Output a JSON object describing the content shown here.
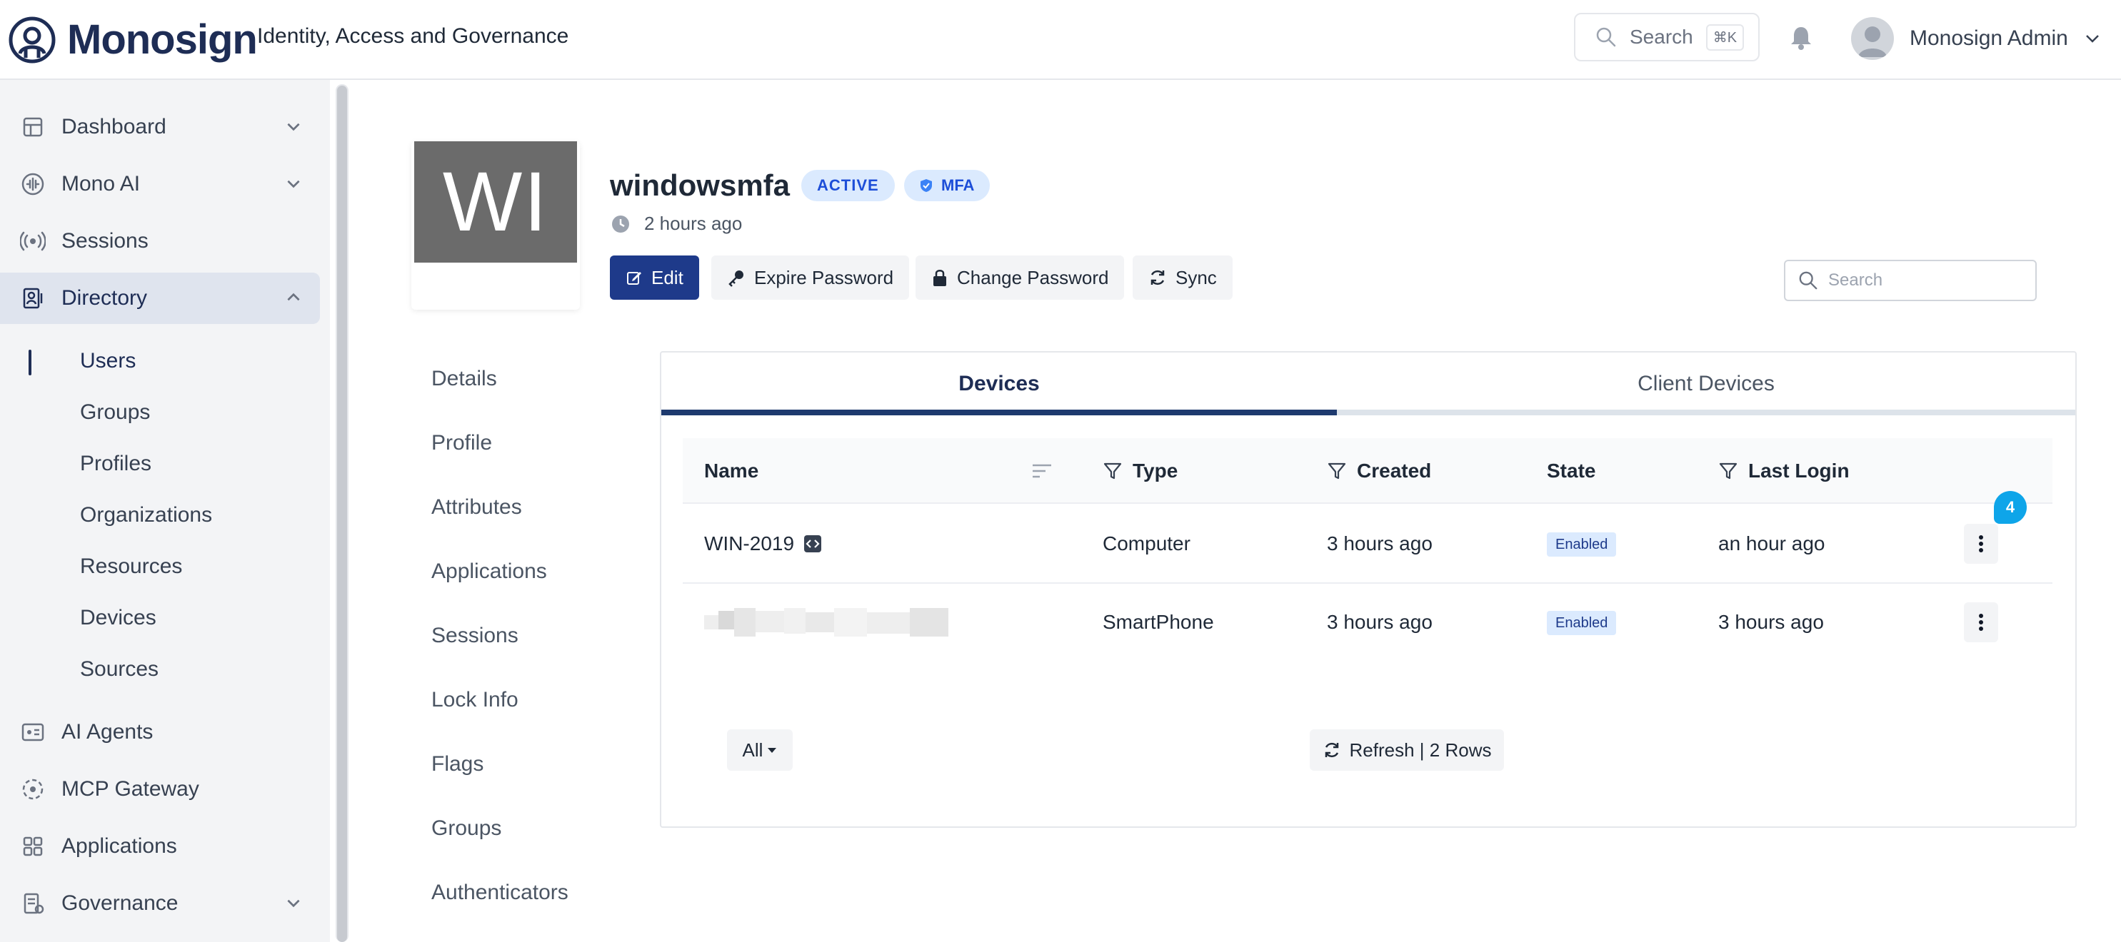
{
  "topbar": {
    "brand": "Monosign",
    "tagline": "Identity, Access and Governance",
    "search_label": "Search",
    "search_shortcut": "⌘K",
    "user_name": "Monosign Admin"
  },
  "sidebar": {
    "items": [
      {
        "label": "Dashboard",
        "icon": "dashboard-icon"
      },
      {
        "label": "Mono AI",
        "icon": "waveform-icon"
      },
      {
        "label": "Sessions",
        "icon": "broadcast-icon"
      },
      {
        "label": "Directory",
        "icon": "directory-icon"
      },
      {
        "label": "AI Agents",
        "icon": "agent-icon"
      },
      {
        "label": "MCP Gateway",
        "icon": "gateway-icon"
      },
      {
        "label": "Applications",
        "icon": "apps-grid-icon"
      },
      {
        "label": "Governance",
        "icon": "governance-icon"
      }
    ],
    "directory_sub": [
      "Users",
      "Groups",
      "Profiles",
      "Organizations",
      "Resources",
      "Devices",
      "Sources"
    ]
  },
  "user": {
    "initials": "WI",
    "name": "windowsmfa",
    "status_badge": "ACTIVE",
    "mfa_badge": "MFA",
    "last_seen": "2 hours ago"
  },
  "actions": {
    "edit": "Edit",
    "expire_password": "Expire Password",
    "change_password": "Change Password",
    "sync": "Sync"
  },
  "table_search": {
    "placeholder": "Search"
  },
  "sections": [
    "Details",
    "Profile",
    "Attributes",
    "Applications",
    "Sessions",
    "Lock Info",
    "Flags",
    "Groups",
    "Authenticators"
  ],
  "tabs": {
    "devices": "Devices",
    "client_devices": "Client Devices"
  },
  "table": {
    "columns": {
      "name": "Name",
      "type": "Type",
      "created": "Created",
      "state": "State",
      "last_login": "Last Login"
    },
    "rows": [
      {
        "name": "WIN-2019",
        "type": "Computer",
        "created": "3 hours ago",
        "state": "Enabled",
        "last_login": "an hour ago"
      },
      {
        "name": "",
        "type": "SmartPhone",
        "created": "3 hours ago",
        "state": "Enabled",
        "last_login": "3 hours ago"
      }
    ],
    "notification_count": "4"
  },
  "footer": {
    "filter_label": "All",
    "refresh_label": "Refresh | 2 Rows"
  },
  "colors": {
    "brand_navy": "#1e2d55",
    "primary_button": "#1e3a8a",
    "badge_bg": "#dbeafe",
    "badge_text": "#1d4ed8",
    "notification": "#0ea5e9"
  }
}
